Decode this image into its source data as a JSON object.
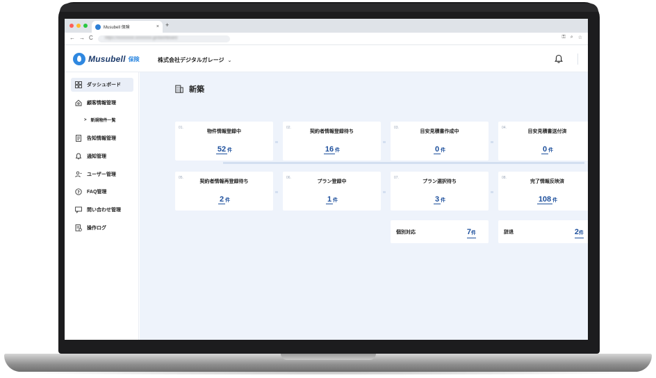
{
  "browser": {
    "tab_title": "Musubell 保険",
    "tab_close": "×",
    "new_tab": "+",
    "url": "https://xxxxxxxx.xxxxxxxx.jp/dashboard",
    "nav_back": "←",
    "nav_forward": "→",
    "nav_reload": "C"
  },
  "header": {
    "logo_name": "Musubell",
    "logo_sub": "保険",
    "company_name": "株式会社デジタルガレージ",
    "company_chevron": "⌄"
  },
  "sidebar": {
    "items": [
      {
        "label": "ダッシュボード",
        "icon": "dashboard-icon"
      },
      {
        "label": "顧客情報管理",
        "icon": "home-icon"
      },
      {
        "label": "告知情報管理",
        "icon": "document-icon"
      },
      {
        "label": "通知管理",
        "icon": "bell-icon"
      },
      {
        "label": "ユーザー管理",
        "icon": "user-icon"
      },
      {
        "label": "FAQ管理",
        "icon": "help-icon"
      },
      {
        "label": "問い合わせ管理",
        "icon": "chat-icon"
      },
      {
        "label": "操作ログ",
        "icon": "log-icon"
      }
    ],
    "sub_item": {
      "label": "新規物件一覧",
      "chevron": ">"
    }
  },
  "main": {
    "section_title": "新築",
    "cards": [
      {
        "num": "01.",
        "label": "物件情報登録中",
        "value": "52",
        "unit": "件"
      },
      {
        "num": "02.",
        "label": "契約者情報登録待ち",
        "value": "16",
        "unit": "件"
      },
      {
        "num": "03.",
        "label": "目安見積書作成中",
        "value": "0",
        "unit": "件"
      },
      {
        "num": "04.",
        "label": "目安見積書送付済",
        "value": "0",
        "unit": "件"
      },
      {
        "num": "05.",
        "label": "契約者情報再登録待ち",
        "value": "2",
        "unit": "件"
      },
      {
        "num": "06.",
        "label": "プラン登録中",
        "value": "1",
        "unit": "件"
      },
      {
        "num": "07.",
        "label": "プラン選択待ち",
        "value": "3",
        "unit": "件"
      },
      {
        "num": "08.",
        "label": "完了情報反映済",
        "value": "108",
        "unit": "件"
      }
    ],
    "small_cards": [
      {
        "label": "個別対応",
        "value": "7",
        "unit": "件"
      },
      {
        "label": "辞退",
        "value": "2",
        "unit": "件"
      }
    ]
  }
}
